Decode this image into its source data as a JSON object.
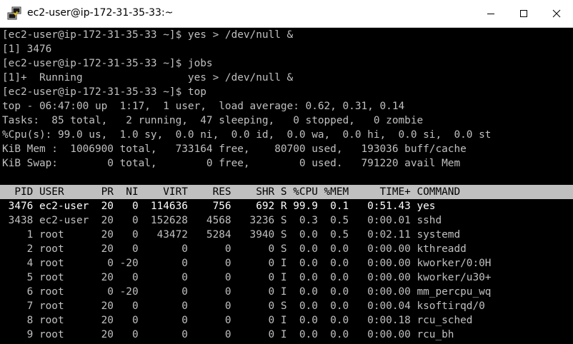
{
  "window": {
    "title": "ec2-user@ip-172-31-35-33:~",
    "icon": "putty-icon",
    "controls": [
      "minimize-icon",
      "maximize-icon",
      "close-icon"
    ]
  },
  "terminal": {
    "colors": {
      "background": "#000000",
      "text": "#c0c0c0",
      "highlight_row_text": "#ffffff",
      "header_bar": "#c0c0c0",
      "header_text": "#000000"
    },
    "lines": [
      "[ec2-user@ip-172-31-35-33 ~]$ yes > /dev/null &",
      "[1] 3476",
      "[ec2-user@ip-172-31-35-33 ~]$ jobs",
      "[1]+  Running                 yes > /dev/null &",
      "[ec2-user@ip-172-31-35-33 ~]$ top",
      "top - 06:47:00 up  1:17,  1 user,  load average: 0.62, 0.31, 0.14",
      "Tasks:  85 total,   2 running,  47 sleeping,   0 stopped,   0 zombie",
      "%Cpu(s): 99.0 us,  1.0 sy,  0.0 ni,  0.0 id,  0.0 wa,  0.0 hi,  0.0 si,  0.0 st",
      "KiB Mem :  1006900 total,   733164 free,    80700 used,   193036 buff/cache",
      "KiB Swap:        0 total,        0 free,        0 used.   791220 avail Mem",
      ""
    ],
    "process_header": "  PID USER      PR  NI    VIRT    RES    SHR S %CPU %MEM     TIME+ COMMAND",
    "process_rows": [
      " 3476 ec2-user  20   0  114636    756    692 R 99.9  0.1   0:51.43 yes",
      " 3438 ec2-user  20   0  152628   4568   3236 S  0.3  0.5   0:00.01 sshd",
      "    1 root      20   0   43472   5284   3940 S  0.0  0.5   0:02.11 systemd",
      "    2 root      20   0       0      0      0 S  0.0  0.0   0:00.00 kthreadd",
      "    4 root       0 -20       0      0      0 I  0.0  0.0   0:00.00 kworker/0:0H",
      "    5 root      20   0       0      0      0 I  0.0  0.0   0:00.00 kworker/u30+",
      "    6 root       0 -20       0      0      0 I  0.0  0.0   0:00.00 mm_percpu_wq",
      "    7 root      20   0       0      0      0 S  0.0  0.0   0:00.04 ksoftirqd/0",
      "    8 root      20   0       0      0      0 I  0.0  0.0   0:00.18 rcu_sched",
      "    9 root      20   0       0      0      0 I  0.0  0.0   0:00.00 rcu_bh"
    ]
  }
}
